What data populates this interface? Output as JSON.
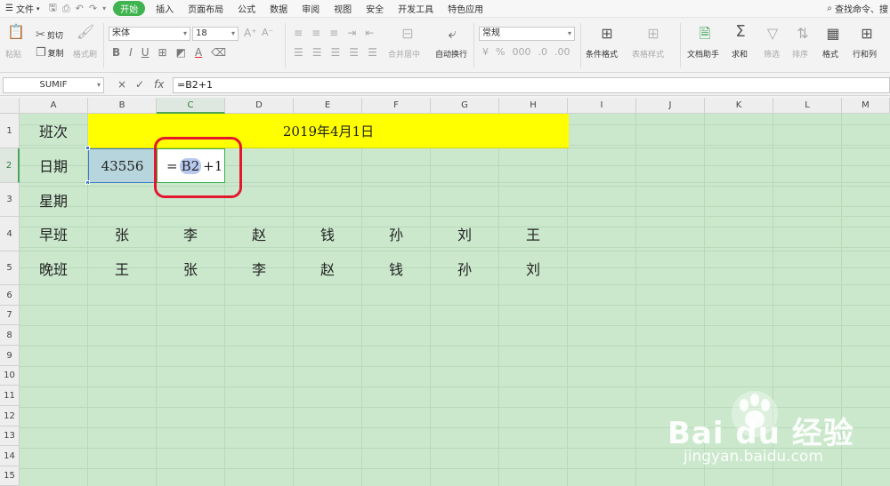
{
  "menubar": {
    "file_label": "文件",
    "tabs": [
      "开始",
      "插入",
      "页面布局",
      "公式",
      "数据",
      "审阅",
      "视图",
      "安全",
      "开发工具",
      "特色应用"
    ],
    "active_tab": "开始",
    "search_label": "查找命令、搜"
  },
  "ribbon": {
    "paste": "粘贴",
    "cut": "剪切",
    "copy": "复制",
    "format_painter": "格式刷",
    "font_name": "宋体",
    "font_size": "18",
    "merge_center": "合并居中",
    "wrap_text": "自动换行",
    "number_format": "常规",
    "conditional_format": "条件格式",
    "table_style": "表格样式",
    "doc_helper": "文档助手",
    "sum": "求和",
    "filter": "筛选",
    "sort": "排序",
    "format": "格式",
    "rows_cols": "行和列"
  },
  "formula_bar": {
    "name_box": "SUMIF",
    "cancel_icon": "×",
    "confirm_icon": "✓",
    "fx_label": "fx",
    "formula": "=B2+1"
  },
  "sheet": {
    "columns": [
      "A",
      "B",
      "C",
      "D",
      "E",
      "F",
      "G",
      "H",
      "I",
      "J",
      "K",
      "L",
      "M"
    ],
    "rows": [
      "1",
      "2",
      "3",
      "4",
      "5",
      "6",
      "7",
      "8",
      "9",
      "10",
      "11",
      "12",
      "13",
      "14",
      "15"
    ],
    "A1": "班次",
    "banner": "2019年4月1日",
    "A2": "日期",
    "B2": "43556",
    "C2_eq": "=",
    "C2_ref": "B2",
    "C2_rest": "+1",
    "A3": "星期",
    "A4": "早班",
    "row4": [
      "张",
      "李",
      "赵",
      "钱",
      "孙",
      "刘",
      "王"
    ],
    "A5": "晚班",
    "row5": [
      "王",
      "张",
      "李",
      "赵",
      "钱",
      "孙",
      "刘"
    ]
  },
  "watermark": {
    "logo": "Bai  du 经验",
    "url": "jingyan.baidu.com"
  },
  "colors": {
    "accent_green": "#3fb34f",
    "sheet_bg": "#cbe8cd",
    "banner_yellow": "#ffff00",
    "highlight_red": "#e3182f"
  }
}
